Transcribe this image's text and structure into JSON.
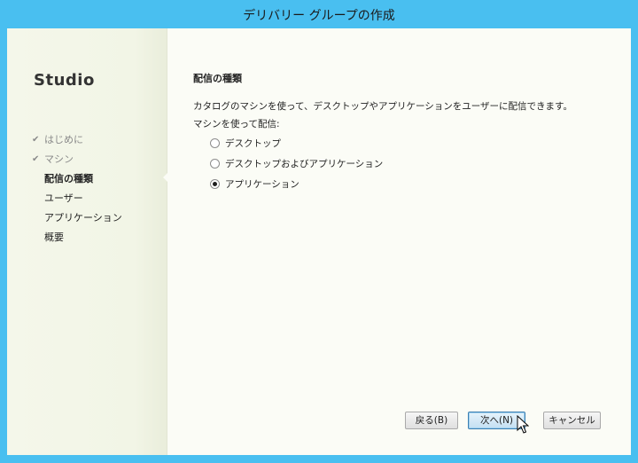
{
  "window": {
    "title": "デリバリー グループの作成"
  },
  "sidebar": {
    "brand": "Studio",
    "steps": [
      {
        "label": "はじめに",
        "state": "done"
      },
      {
        "label": "マシン",
        "state": "done"
      },
      {
        "label": "配信の種類",
        "state": "current"
      },
      {
        "label": "ユーザー",
        "state": "pending"
      },
      {
        "label": "アプリケーション",
        "state": "pending"
      },
      {
        "label": "概要",
        "state": "pending"
      }
    ]
  },
  "main": {
    "section_title": "配信の種類",
    "description": "カタログのマシンを使って、デスクトップやアプリケーションをユーザーに配信できます。",
    "group_label": "マシンを使って配信:",
    "options": [
      {
        "label": "デスクトップ",
        "selected": false
      },
      {
        "label": "デスクトップおよびアプリケーション",
        "selected": false
      },
      {
        "label": "アプリケーション",
        "selected": true
      }
    ]
  },
  "buttons": {
    "back": "戻る(B)",
    "next": "次へ(N)",
    "cancel": "キャンセル"
  },
  "colors": {
    "frame": "#49bff0",
    "client": "#fbfcf6",
    "sidebar": "#f2f5e6",
    "primary_button_border": "#3c7fb1"
  }
}
